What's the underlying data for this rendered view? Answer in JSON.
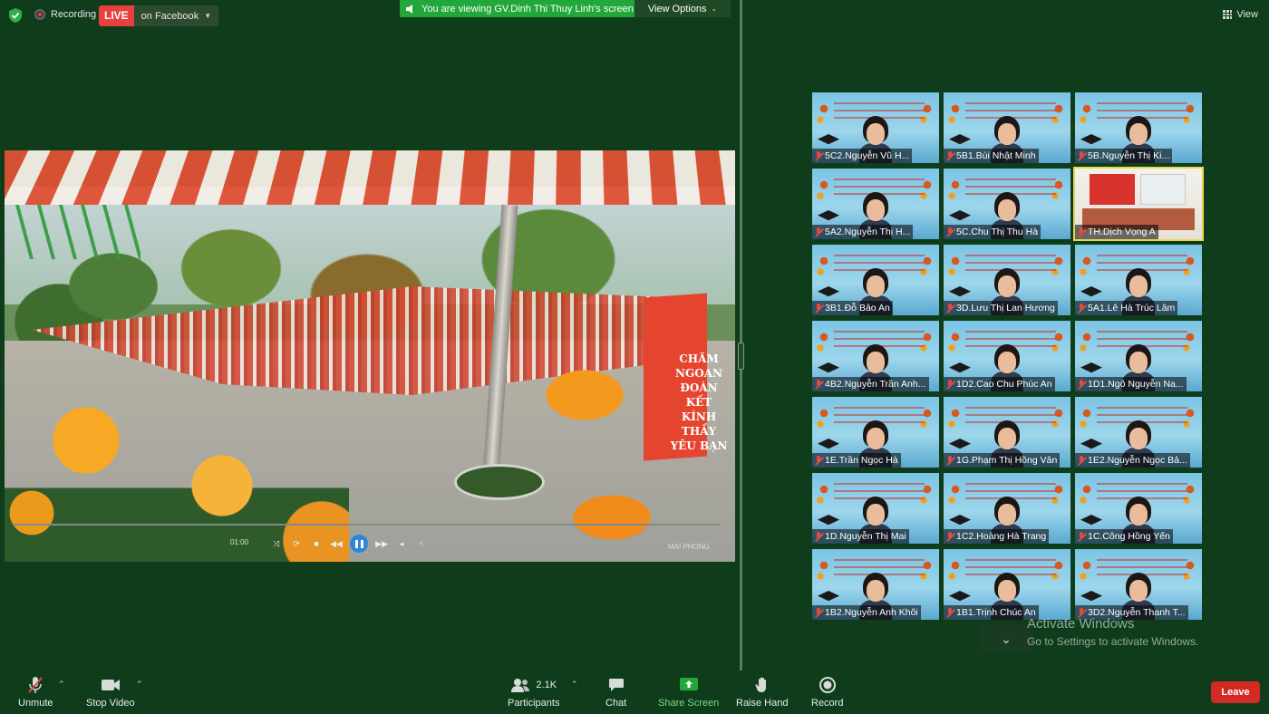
{
  "topbar": {
    "recording_label": "Recording",
    "live_label": "LIVE",
    "live_target": "on Facebook",
    "viewing_text": "You are viewing GV.Dinh Thi Thuy Linh's screen",
    "view_options_label": "View Options",
    "view_label": "View"
  },
  "shared_video": {
    "banner_text": [
      "CHĂM",
      "NGOAN",
      "ĐOÀN KẾT",
      "KÍNH THẦY",
      "YÊU BẠN"
    ],
    "time": "01:00",
    "watermark": "MAI PHONG"
  },
  "participants": [
    {
      "name": "5C2.Nguyễn Vũ H..."
    },
    {
      "name": "5B1.Bùi Nhật Minh"
    },
    {
      "name": "5B.Nguyễn Thị Ki..."
    },
    {
      "name": "5A2.Nguyễn Thị H..."
    },
    {
      "name": "5C.Chu Thị Thu Hà"
    },
    {
      "name": "TH.Dịch Vọng A",
      "active": true
    },
    {
      "name": "3B1.Đỗ Bảo An"
    },
    {
      "name": "3D.Lưu Thị Lan Hương"
    },
    {
      "name": "5A1.Lê Hà Trúc Lâm"
    },
    {
      "name": "4B2.Nguyễn Trần Anh..."
    },
    {
      "name": "1D2.Cao Chu Phúc An"
    },
    {
      "name": "1D1.Ngô Nguyễn Na..."
    },
    {
      "name": "1E.Trần Ngọc Hà"
    },
    {
      "name": "1G.Phạm Thị Hồng Vân"
    },
    {
      "name": "1E2.Nguyễn Ngọc Bả..."
    },
    {
      "name": "1D.Nguyễn Thị Mai"
    },
    {
      "name": "1C2.Hoàng Hà Trang"
    },
    {
      "name": "1C.Công Hồng Yến"
    },
    {
      "name": "1B2.Nguyễn Anh Khôi"
    },
    {
      "name": "1B1.Trịnh Chúc An"
    },
    {
      "name": "3D2.Nguyễn Thanh T..."
    }
  ],
  "watermark": {
    "line1": "Activate Windows",
    "line2": "Go to Settings to activate Windows."
  },
  "toolbar": {
    "unmute": "Unmute",
    "stop_video": "Stop Video",
    "participants": "Participants",
    "participants_count": "2.1K",
    "chat": "Chat",
    "share_screen": "Share Screen",
    "raise_hand": "Raise Hand",
    "record": "Record",
    "leave": "Leave"
  },
  "colors": {
    "background": "#0f3d1c",
    "live": "#e8403c",
    "viewing_banner": "#22a83a",
    "leave": "#d42a25",
    "active_speaker": "#e7d84b"
  }
}
